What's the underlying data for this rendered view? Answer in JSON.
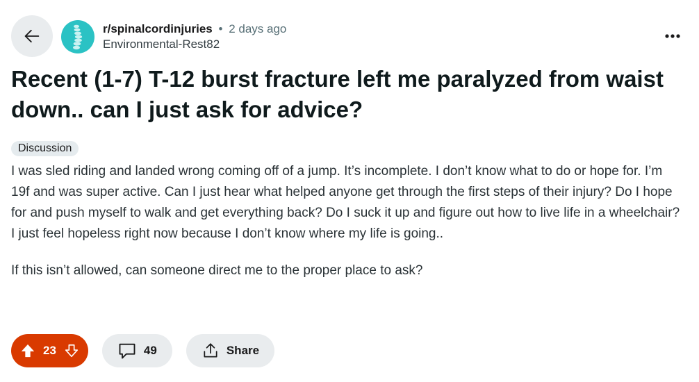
{
  "header": {
    "subreddit": "r/spinalcordinjuries",
    "separator": "•",
    "time_ago": "2 days ago",
    "author": "Environmental-Rest82"
  },
  "post": {
    "title": "Recent (1-7) T-12 burst fracture left me paralyzed from waist down.. can I just ask for advice?",
    "flair": "Discussion",
    "paragraphs": [
      "I was sled riding and landed wrong coming off of a jump. It’s incomplete. I don’t know what to do or hope for. I’m 19f and was super active. Can I just hear what helped anyone get through the first steps of their injury? Do I hope for and push myself to walk and get everything back? Do I suck it up and figure out how to live life in a wheelchair? I just feel hopeless right now because I don’t know where my life is going..",
      "If this isn’t allowed, can someone direct me to the proper place to ask?"
    ]
  },
  "actions": {
    "vote_count": "23",
    "comment_count": "49",
    "share_label": "Share"
  },
  "icons": {
    "back": "arrow-left-icon",
    "more": "more-horizontal-icon",
    "upvote": "upvote-arrow-icon",
    "downvote": "downvote-arrow-icon",
    "comment": "comment-bubble-icon",
    "share": "share-upload-icon"
  },
  "colors": {
    "vote_bg": "#d93a00",
    "avatar_bg": "#2bc2c4",
    "pill_bg": "#e9ecee"
  }
}
